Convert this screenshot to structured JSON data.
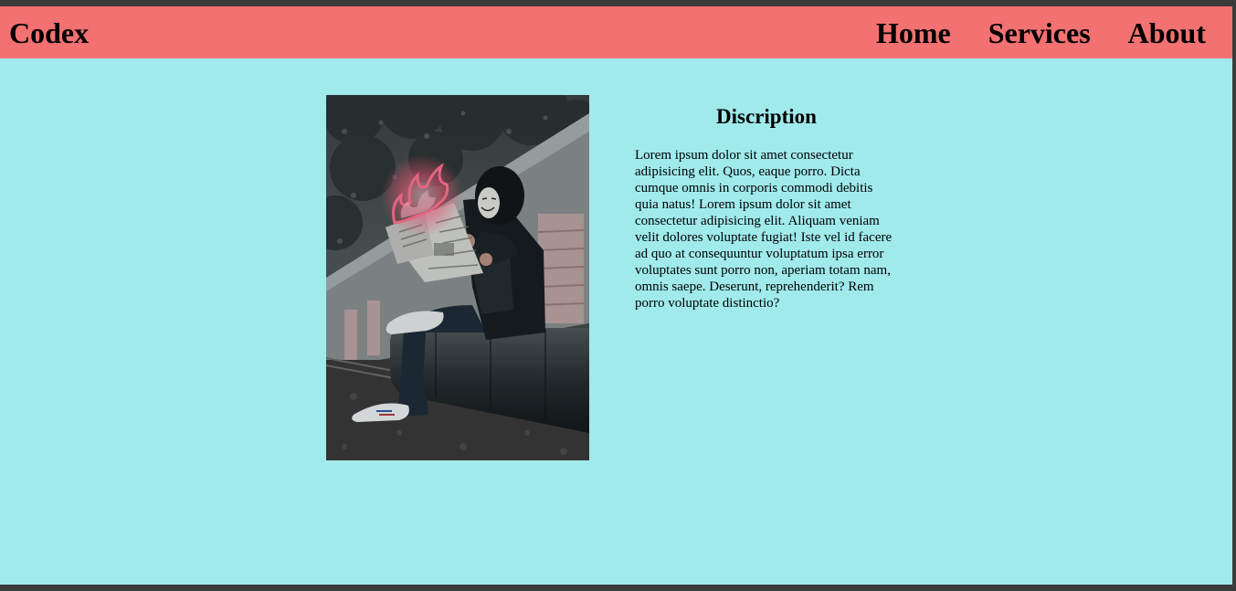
{
  "navbar": {
    "logo": "Codex",
    "links": [
      "Home",
      "Services",
      "About"
    ]
  },
  "main": {
    "image_alt": "Masked person in hoodie reading a burning newspaper",
    "description_title": "Discription",
    "description_text": "Lorem ipsum dolor sit amet consectetur adipisicing elit. Quos, eaque porro. Dicta cumque omnis in corporis commodi debitis quia natus! Lorem ipsum dolor sit amet consectetur adipisicing elit. Aliquam veniam velit dolores voluptate fugiat! Iste vel id facere ad quo at consequuntur voluptatum ipsa error voluptates sunt porro non, aperiam totam nam, omnis saepe. Deserunt, reprehenderit? Rem porro voluptate distinctio?"
  },
  "colors": {
    "navbar_bg": "#f37171",
    "page_bg": "#a0eaec",
    "text": "#000000"
  }
}
